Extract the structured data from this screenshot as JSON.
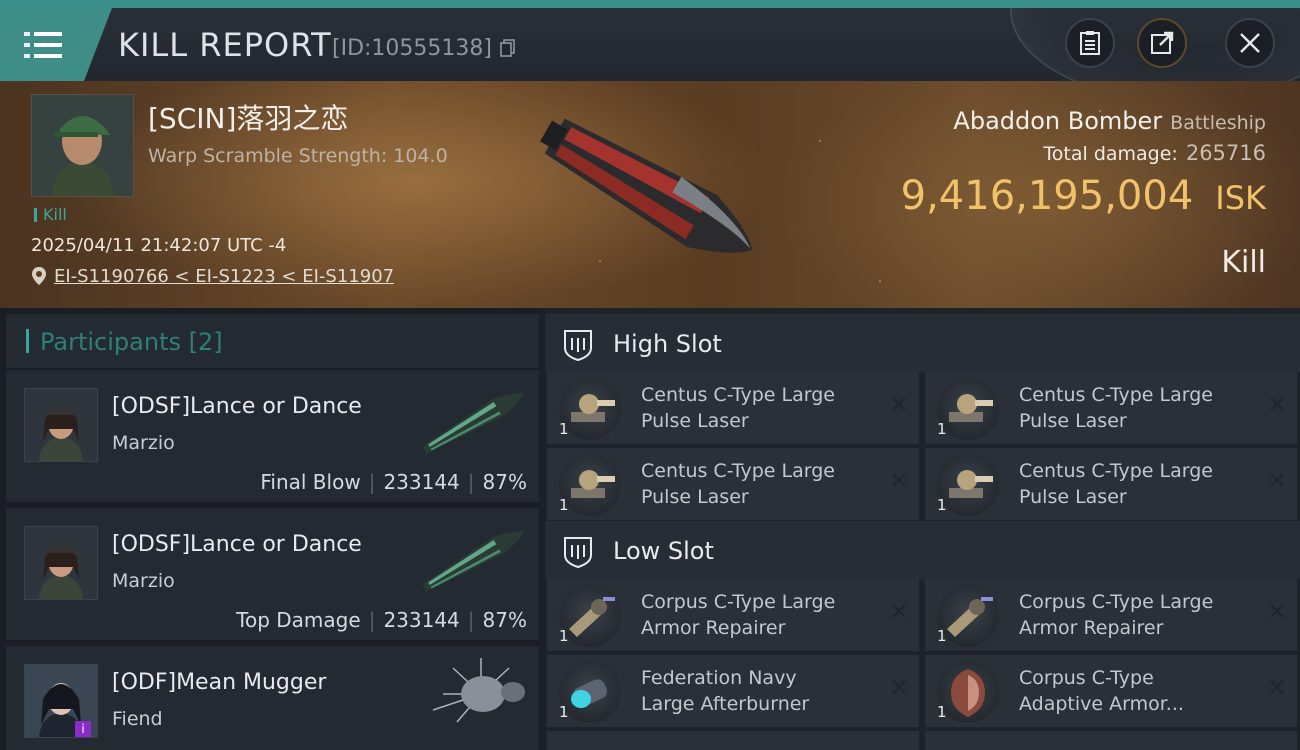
{
  "header": {
    "title": "KILL REPORT",
    "kill_id": "[ID:10555138]"
  },
  "victim": {
    "name": "[SCIN]落羽之恋",
    "warp_scramble": "Warp Scramble Strength: 104.0",
    "tag": "Kill",
    "datetime": "2025/04/11 21:42:07 UTC -4",
    "location": "EI-S1190766 < EI-S1223 < EI-S11907",
    "ship_name": "Abaddon Bomber",
    "ship_class": "Battleship",
    "total_damage_label": "Total damage:",
    "total_damage_value": "265716",
    "isk_value": "9,416,195,004",
    "isk_unit": "ISK",
    "result": "Kill"
  },
  "participants": {
    "label": "Participants [2]",
    "items": [
      {
        "name": "[ODSF]Lance or Dance",
        "corp": "Marzio",
        "role": "Final Blow",
        "damage": "233144",
        "percent": "87%"
      },
      {
        "name": "[ODSF]Lance or Dance",
        "corp": "Marzio",
        "role": "Top Damage",
        "damage": "233144",
        "percent": "87%"
      },
      {
        "name": "[ODF]Mean Mugger",
        "corp": "Fiend",
        "badge": "i"
      }
    ]
  },
  "slots": {
    "high": {
      "label": "High Slot",
      "items": [
        {
          "line1": "Centus C-Type Large",
          "line2": "Pulse Laser",
          "qty": "1"
        },
        {
          "line1": "Centus C-Type Large",
          "line2": "Pulse Laser",
          "qty": "1"
        },
        {
          "line1": "Centus C-Type Large",
          "line2": "Pulse Laser",
          "qty": "1"
        },
        {
          "line1": "Centus C-Type Large",
          "line2": "Pulse Laser",
          "qty": "1"
        }
      ]
    },
    "low": {
      "label": "Low Slot",
      "items": [
        {
          "line1": "Corpus C-Type Large",
          "line2": "Armor Repairer",
          "qty": "1"
        },
        {
          "line1": "Corpus C-Type Large",
          "line2": "Armor Repairer",
          "qty": "1"
        },
        {
          "line1": "Federation Navy",
          "line2": "Large Afterburner",
          "qty": "1"
        },
        {
          "line1": "Corpus C-Type",
          "line2": "Adaptive Armor...",
          "qty": "1"
        }
      ]
    }
  },
  "colors": {
    "accent": "#3e8d87",
    "isk": "#f1c26a",
    "tag": "#3aa69c"
  },
  "icons": [
    "menu-icon",
    "copy-icon",
    "clipboard-icon",
    "share-icon",
    "close-icon",
    "location-pin-icon",
    "shield-slot-icon",
    "remove-icon"
  ]
}
